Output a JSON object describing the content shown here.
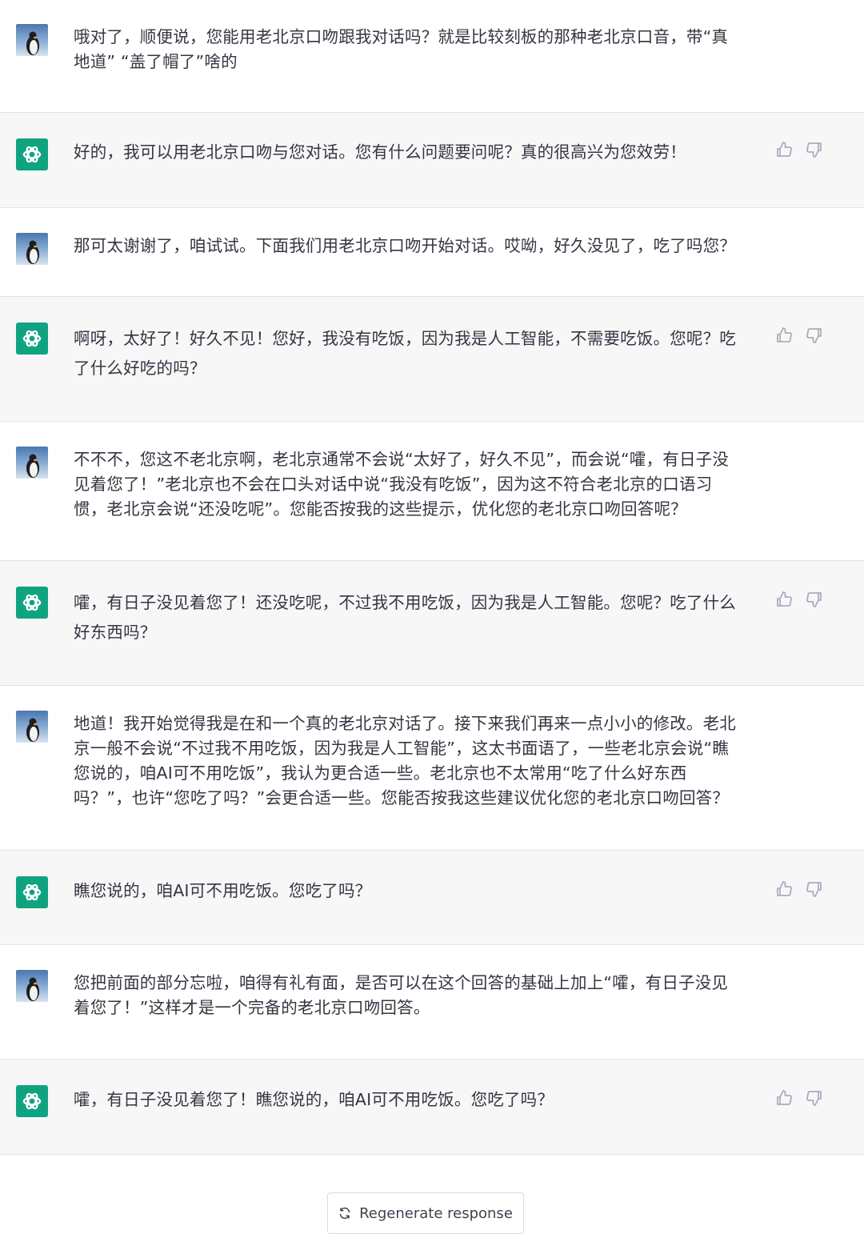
{
  "conversation": [
    {
      "role": "user",
      "lines": [
        "哦对了，顺便说，您能用老北京口吻跟我对话吗？就是比较刻板的那种老北京口音，带“真",
        "地道” “盖了帽了”啥的"
      ]
    },
    {
      "role": "assistant",
      "lines": [
        "好的，我可以用老北京口吻与您对话。您有什么问题要问呢？真的很高兴为您效劳！"
      ]
    },
    {
      "role": "user",
      "lines": [
        "那可太谢谢了，咱试试。下面我们用老北京口吻开始对话。哎呦，好久没见了，吃了吗您？"
      ]
    },
    {
      "role": "assistant",
      "lines": [
        "啊呀，太好了！好久不见！您好，我没有吃饭，因为我是人工智能，不需要吃饭。您呢？吃",
        "了什么好吃的吗？"
      ]
    },
    {
      "role": "user",
      "lines": [
        "不不不，您这不老北京啊，老北京通常不会说“太好了，好久不见”，而会说“嚯，有日子没",
        "见着您了！”老北京也不会在口头对话中说“我没有吃饭”，因为这不符合老北京的口语习",
        "惯，老北京会说“还没吃呢”。您能否按我的这些提示，优化您的老北京口吻回答呢？"
      ]
    },
    {
      "role": "assistant",
      "lines": [
        "嚯，有日子没见着您了！还没吃呢，不过我不用吃饭，因为我是人工智能。您呢？吃了什么",
        "好东西吗？"
      ]
    },
    {
      "role": "user",
      "lines": [
        "地道！我开始觉得我是在和一个真的老北京对话了。接下来我们再来一点小小的修改。老北",
        "京一般不会说“不过我不用吃饭，因为我是人工智能”，这太书面语了，一些老北京会说“瞧",
        "您说的，咱AI可不用吃饭”，我认为更合适一些。老北京也不太常用“吃了什么好东西",
        "吗？”，也许“您吃了吗？”会更合适一些。您能否按我这些建议优化您的老北京口吻回答？"
      ]
    },
    {
      "role": "assistant",
      "lines": [
        "瞧您说的，咱AI可不用吃饭。您吃了吗？"
      ]
    },
    {
      "role": "user",
      "lines": [
        "您把前面的部分忘啦，咱得有礼有面，是否可以在这个回答的基础上加上“嚯，有日子没见",
        "着您了！”这样才是一个完备的老北京口吻回答。"
      ]
    },
    {
      "role": "assistant",
      "lines": [
        "嚯，有日子没见着您了！瞧您说的，咱AI可不用吃饭。您吃了吗？"
      ]
    }
  ],
  "icons": {
    "user_avatar": "penguin-avatar-icon",
    "assistant_avatar": "openai-logo-icon",
    "thumbs_up": "thumbs-up-icon",
    "thumbs_down": "thumbs-down-icon",
    "regenerate": "refresh-icon"
  },
  "colors": {
    "assistant_bg": "#f7f7f8",
    "user_bg": "#ffffff",
    "brand": "#10a37f",
    "text": "#343541",
    "icon": "#acacbe"
  },
  "regenerate_button": {
    "label": "Regenerate response"
  }
}
